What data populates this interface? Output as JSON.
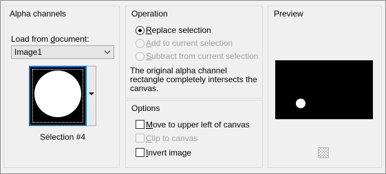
{
  "alpha_channels": {
    "title": "Alpha channels",
    "load_label_prefix": "Load from ",
    "load_label_underlined": "d",
    "load_label_suffix": "ocument:",
    "document_selected": "Image1",
    "thumbnail_caption": "Sélection #4"
  },
  "operation": {
    "title": "Operation",
    "options": [
      {
        "underline": "R",
        "rest": "eplace selection",
        "checked": true,
        "enabled": true
      },
      {
        "underline": "A",
        "rest": "dd to current selection",
        "checked": false,
        "enabled": false
      },
      {
        "underline": "S",
        "rest": "ubtract from current selection",
        "checked": false,
        "enabled": false
      }
    ],
    "description": "The original alpha channel rectangle completely intersects the canvas."
  },
  "options": {
    "title": "Options",
    "items": [
      {
        "underline": "M",
        "rest": "ove to upper left of canvas",
        "checked": false,
        "enabled": true
      },
      {
        "underline": "C",
        "rest": "lip to canvas",
        "checked": false,
        "enabled": false
      },
      {
        "underline": "I",
        "rest": "nvert image",
        "checked": false,
        "enabled": true
      }
    ]
  },
  "preview": {
    "title": "Preview"
  },
  "icons": {
    "dropdown": "chevron-down-icon",
    "transparency": "checkerboard-icon"
  },
  "colors": {
    "accent": "#0078d7",
    "panel_bg": "#f0f0f0"
  }
}
